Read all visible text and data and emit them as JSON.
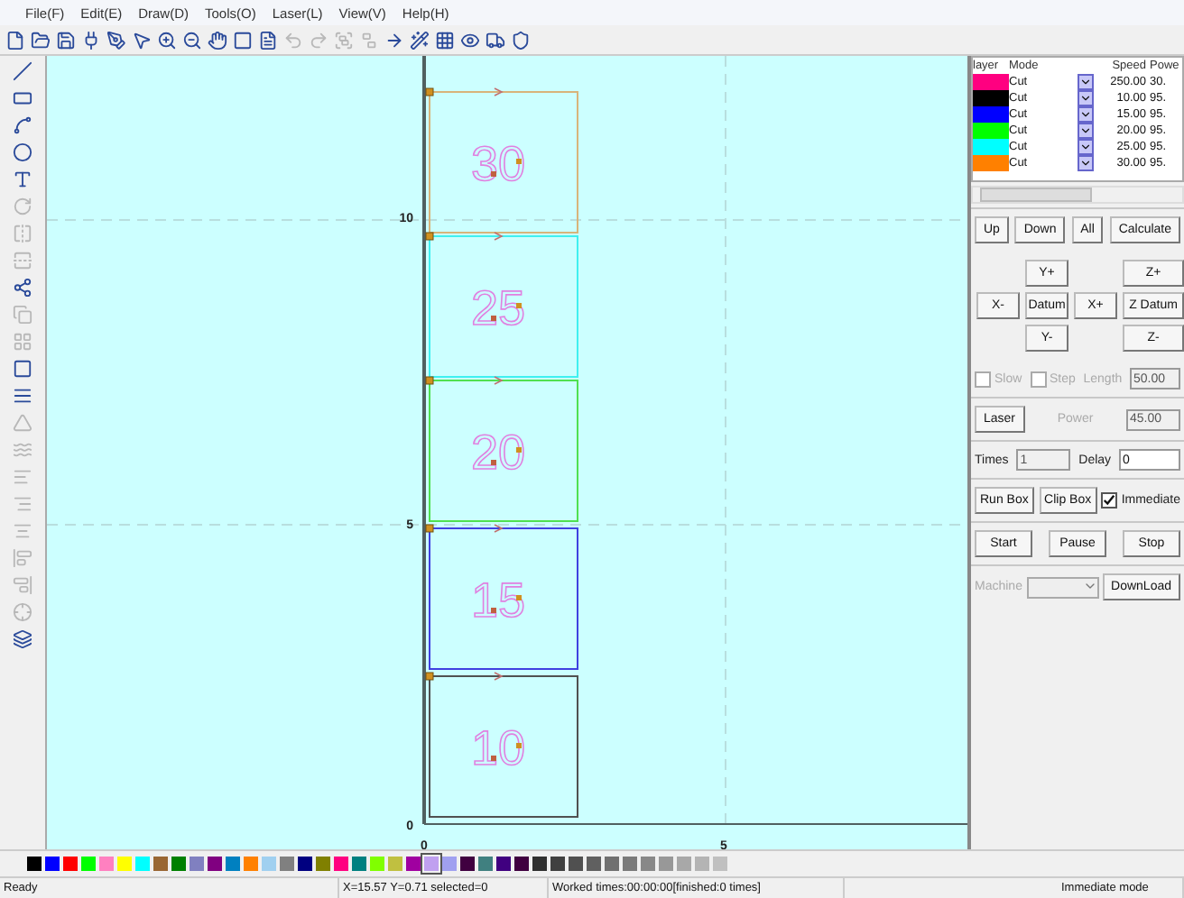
{
  "menu": [
    "File(F)",
    "Edit(E)",
    "Draw(D)",
    "Tools(O)",
    "Laser(L)",
    "View(V)",
    "Help(H)"
  ],
  "toolbar": [
    {
      "disabled": false
    },
    {
      "disabled": false
    },
    {
      "disabled": false
    },
    {
      "disabled": false
    },
    {
      "disabled": false
    },
    {
      "disabled": false
    },
    {
      "disabled": false
    },
    {
      "disabled": false
    },
    {
      "disabled": false
    },
    {
      "disabled": false
    },
    {
      "disabled": false
    },
    {
      "disabled": true
    },
    {
      "disabled": true
    },
    {
      "disabled": true
    },
    {
      "disabled": true
    },
    {
      "disabled": false
    },
    {
      "disabled": false
    },
    {
      "disabled": false
    },
    {
      "disabled": false
    },
    {
      "disabled": false
    },
    {
      "disabled": false
    }
  ],
  "tools": [
    {
      "disabled": false
    },
    {
      "disabled": false
    },
    {
      "disabled": false
    },
    {
      "disabled": false
    },
    {
      "disabled": false
    },
    {
      "disabled": true
    },
    {
      "disabled": true
    },
    {
      "disabled": true
    },
    {
      "disabled": false
    },
    {
      "disabled": true
    },
    {
      "disabled": true
    },
    {
      "disabled": false
    },
    {
      "disabled": false
    },
    {
      "disabled": true
    },
    {
      "disabled": true
    },
    {
      "disabled": true
    },
    {
      "disabled": true
    },
    {
      "disabled": true
    },
    {
      "disabled": true
    },
    {
      "disabled": true
    },
    {
      "disabled": true
    },
    {
      "disabled": false
    }
  ],
  "canvas": {
    "y_labels": [
      "10",
      "5",
      "0"
    ],
    "x_labels": [
      "0",
      "5"
    ],
    "items": [
      {
        "label": "30",
        "color": "#d8b47a"
      },
      {
        "label": "25",
        "color": "#40f0f0"
      },
      {
        "label": "20",
        "color": "#50e050"
      },
      {
        "label": "15",
        "color": "#4040e0"
      },
      {
        "label": "10",
        "color": "#505050"
      }
    ]
  },
  "layers": {
    "columns": [
      "layer",
      "Mode",
      "Speed",
      "Powe"
    ],
    "rows": [
      {
        "color": "#ff0080",
        "mode": "Cut",
        "speed": "250.00",
        "power": "30."
      },
      {
        "color": "#000000",
        "mode": "Cut",
        "speed": "10.00",
        "power": "95."
      },
      {
        "color": "#0000ff",
        "mode": "Cut",
        "speed": "15.00",
        "power": "95."
      },
      {
        "color": "#00ff00",
        "mode": "Cut",
        "speed": "20.00",
        "power": "95."
      },
      {
        "color": "#00ffff",
        "mode": "Cut",
        "speed": "25.00",
        "power": "95."
      },
      {
        "color": "#ff8000",
        "mode": "Cut",
        "speed": "30.00",
        "power": "95."
      }
    ]
  },
  "controls": {
    "move_buttons": [
      "Up",
      "Down",
      "All",
      "Calculate"
    ],
    "jog": [
      "Y+",
      "Z+",
      "X-",
      "Datum",
      "X+",
      "Z Datum",
      "Y-",
      "Z-"
    ],
    "options": [
      {
        "label": "Slow",
        "checked": false,
        "disabled": true
      },
      {
        "label": "Step",
        "checked": false,
        "disabled": true
      }
    ],
    "length": {
      "label": "Length",
      "value": "50.00",
      "disabled": true
    },
    "laser_button": "Laser",
    "power": {
      "label": "Power",
      "value": "45.00",
      "disabled": true
    },
    "times": {
      "label": "Times",
      "value": "1",
      "disabled": true
    },
    "delay": {
      "label": "Delay",
      "value": "0",
      "disabled": false
    },
    "box_buttons": [
      "Run Box",
      "Clip Box"
    ],
    "immediate": {
      "label": "Immediate",
      "checked": true,
      "disabled": false
    },
    "run_buttons": [
      "Start",
      "Pause",
      "Stop"
    ],
    "machine": {
      "label": "Machine",
      "disabled": true
    },
    "download": "DownLoad"
  },
  "palette": [
    {
      "color": "#000000",
      "selected": false
    },
    {
      "color": "#0000ff",
      "selected": false
    },
    {
      "color": "#ff0000",
      "selected": false
    },
    {
      "color": "#00ff00",
      "selected": false
    },
    {
      "color": "#ff80c0",
      "selected": false
    },
    {
      "color": "#ffff00",
      "selected": false
    },
    {
      "color": "#00ffff",
      "selected": false
    },
    {
      "color": "#996633",
      "selected": false
    },
    {
      "color": "#008000",
      "selected": false
    },
    {
      "color": "#8080c0",
      "selected": false
    },
    {
      "color": "#800080",
      "selected": false
    },
    {
      "color": "#0080c0",
      "selected": false
    },
    {
      "color": "#ff8000",
      "selected": false
    },
    {
      "color": "#a0d0f0",
      "selected": false
    },
    {
      "color": "#808080",
      "selected": false
    },
    {
      "color": "#000080",
      "selected": false
    },
    {
      "color": "#808000",
      "selected": false
    },
    {
      "color": "#ff0080",
      "selected": false
    },
    {
      "color": "#008080",
      "selected": false
    },
    {
      "color": "#80ff00",
      "selected": false
    },
    {
      "color": "#c0c040",
      "selected": false
    },
    {
      "color": "#a000a0",
      "selected": false
    },
    {
      "color": "#c0a0f0",
      "selected": true
    },
    {
      "color": "#a0a0f0",
      "selected": false
    },
    {
      "color": "#400040",
      "selected": false
    },
    {
      "color": "#408080",
      "selected": false
    },
    {
      "color": "#400080",
      "selected": false
    },
    {
      "color": "#400040",
      "selected": false
    },
    {
      "color": "#303030",
      "selected": false
    },
    {
      "color": "#404040",
      "selected": false
    },
    {
      "color": "#505050",
      "selected": false
    },
    {
      "color": "#606060",
      "selected": false
    },
    {
      "color": "#707070",
      "selected": false
    },
    {
      "color": "#7a7a7a",
      "selected": false
    },
    {
      "color": "#888888",
      "selected": false
    },
    {
      "color": "#989898",
      "selected": false
    },
    {
      "color": "#a8a8a8",
      "selected": false
    },
    {
      "color": "#b4b4b4",
      "selected": false
    },
    {
      "color": "#c0c0c0",
      "selected": false
    }
  ],
  "status_bar": [
    "Ready",
    "X=15.57 Y=0.71 selected=0",
    "Worked times:00:00:00[finished:0 times]",
    "Immediate mode"
  ]
}
